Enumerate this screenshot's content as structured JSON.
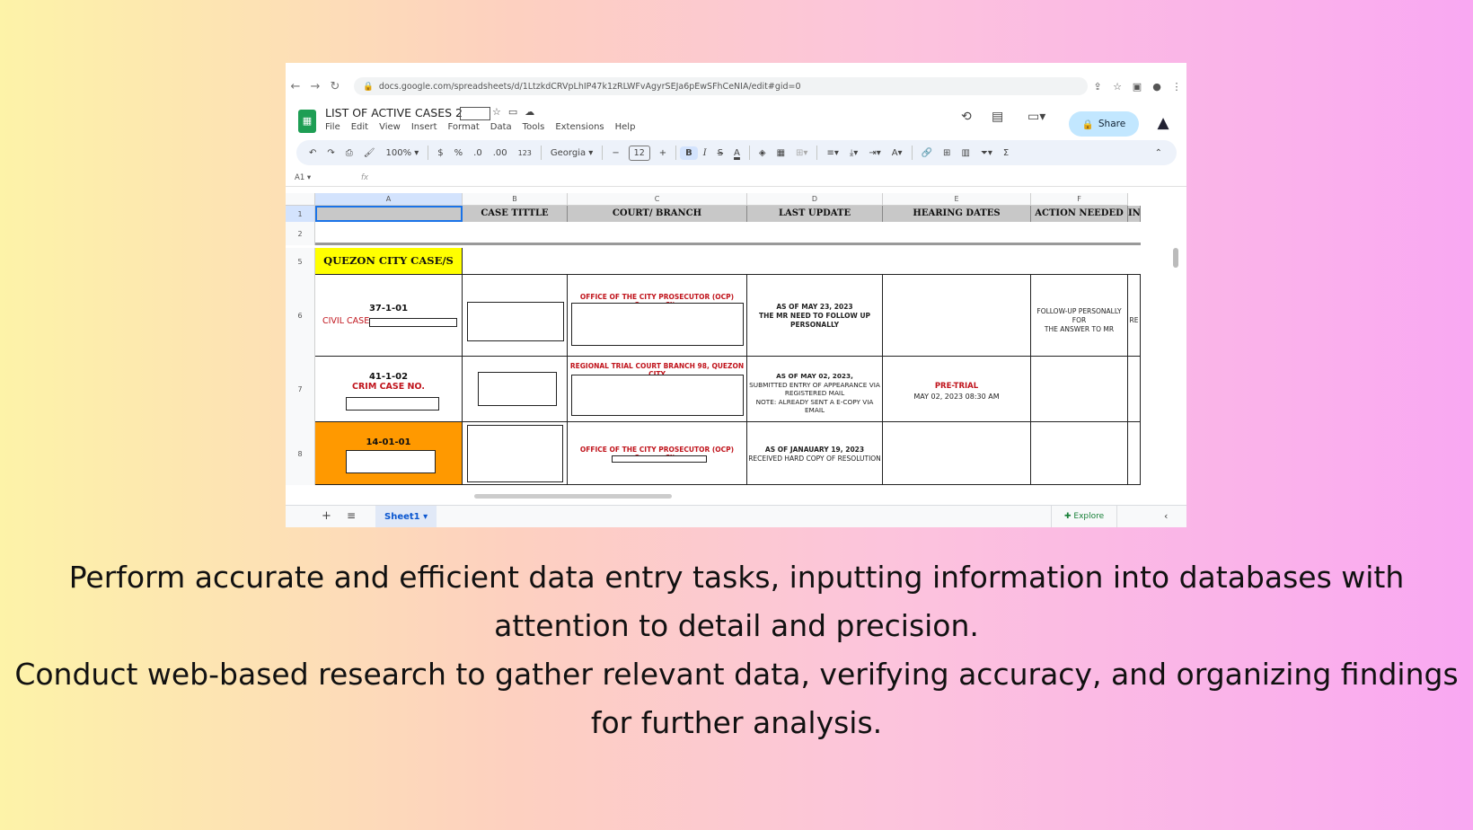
{
  "browser": {
    "url": "docs.google.com/spreadsheets/d/1LtzkdCRVpLhIP47k1zRLWFvAgyrSEJa6pEwSFhCeNIA/edit#gid=0"
  },
  "doc": {
    "title": "LIST OF ACTIVE CASES 2",
    "menu": [
      "File",
      "Edit",
      "View",
      "Insert",
      "Format",
      "Data",
      "Tools",
      "Extensions",
      "Help"
    ],
    "share_label": "Share"
  },
  "toolbar": {
    "zoom": "100%",
    "currency": "$",
    "percent": "%",
    "dec_dec": ".0",
    "dec_inc": ".00",
    "format_num": "123",
    "font": "Georgia",
    "font_size": "12",
    "bold": "B",
    "italic": "I",
    "strike": "S",
    "text_color": "A",
    "sum": "Σ"
  },
  "formula_bar": {
    "cell_ref": "A1",
    "fx": "fx"
  },
  "columns": [
    "A",
    "B",
    "C",
    "D",
    "E",
    "F"
  ],
  "headers": [
    "CASE TITTLE",
    "COURT/ BRANCH",
    "LAST UPDATE",
    "HEARING DATES",
    "ACTION NEEDED",
    "IN"
  ],
  "row_numbers": [
    "1",
    "2",
    "5",
    "6",
    "7",
    "8"
  ],
  "section_label": "QUEZON CITY CASE/S",
  "rows": [
    {
      "id": "37-1-01",
      "sub": "CIVIL CASE",
      "court": "OFFICE OF THE CITY PROSECUTOR (OCP) Quezon City",
      "update": [
        "AS OF MAY 23, 2023",
        "THE MR NEED TO FOLLOW UP",
        "PERSONALLY"
      ],
      "hearing_title": "",
      "hearing_date": "",
      "action": [
        "FOLLOW-UP PERSONALLY FOR",
        "THE ANSWER TO MR"
      ],
      "extra": "RE"
    },
    {
      "id": "41-1-02",
      "sub": "CRIM CASE NO.",
      "court": "REGIONAL TRIAL COURT BRANCH 98, QUEZON CITY",
      "update": [
        "AS OF MAY 02, 2023,",
        "SUBMITTED ENTRY OF APPEARANCE VIA",
        "REGISTERED MAIL",
        "NOTE: ALREADY SENT A E-COPY VIA EMAIL"
      ],
      "hearing_title": "PRE-TRIAL",
      "hearing_date": "MAY 02, 2023 08:30 AM",
      "action": [],
      "extra": ""
    },
    {
      "id": "14-01-01",
      "sub": "",
      "court": "OFFICE OF THE CITY PROSECUTOR (OCP) Quezon City",
      "update": [
        "AS OF JANAUARY 19, 2023",
        "RECEIVED HARD COPY OF RESOLUTION"
      ],
      "hearing_title": "",
      "hearing_date": "",
      "action": [],
      "extra": ""
    }
  ],
  "sheet": {
    "tab": "Sheet1",
    "explore": "Explore"
  },
  "caption": {
    "line1": "Perform accurate and efficient data entry tasks, inputting information into databases with",
    "line2": "attention to detail and precision.",
    "line3": "Conduct web-based research to gather relevant data, verifying accuracy, and organizing findings",
    "line4": "for further analysis."
  },
  "colors": {
    "section_yellow": "#ffff00",
    "row_orange": "#ff9900",
    "accent_red": "#c0141c",
    "share_blue": "#c2e7ff"
  }
}
